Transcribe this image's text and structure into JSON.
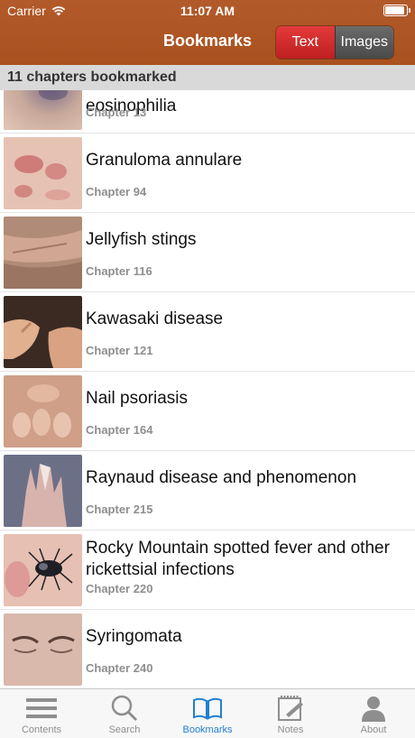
{
  "status_bar": {
    "carrier": "Carrier",
    "time": "11:07 AM",
    "battery_level": 1.0
  },
  "nav": {
    "title": "Bookmarks"
  },
  "segmented": {
    "text_label": "Text",
    "images_label": "Images",
    "selected": "Text"
  },
  "section": {
    "header": "11 chapters bookmarked"
  },
  "bookmarks": [
    {
      "title": "eosinophilia",
      "chapter": "Chapter 13"
    },
    {
      "title": "Granuloma annulare",
      "chapter": "Chapter 94"
    },
    {
      "title": "Jellyfish stings",
      "chapter": "Chapter 116"
    },
    {
      "title": "Kawasaki disease",
      "chapter": "Chapter 121"
    },
    {
      "title": "Nail psoriasis",
      "chapter": "Chapter 164"
    },
    {
      "title": "Raynaud disease and phenomenon",
      "chapter": "Chapter 215"
    },
    {
      "title": "Rocky Mountain spotted fever and other rickettsial infections",
      "chapter": "Chapter 220"
    },
    {
      "title": "Syringomata",
      "chapter": "Chapter 240"
    }
  ],
  "tabbar": {
    "contents": "Contents",
    "search": "Search",
    "bookmarks": "Bookmarks",
    "notes": "Notes",
    "about": "About"
  },
  "colors": {
    "header_bg": "#ad5424",
    "segment_selected": "#d42d2d",
    "segment_unselected": "#595959",
    "tab_active": "#1f7fd1",
    "tab_inactive": "#8e8e8e"
  }
}
